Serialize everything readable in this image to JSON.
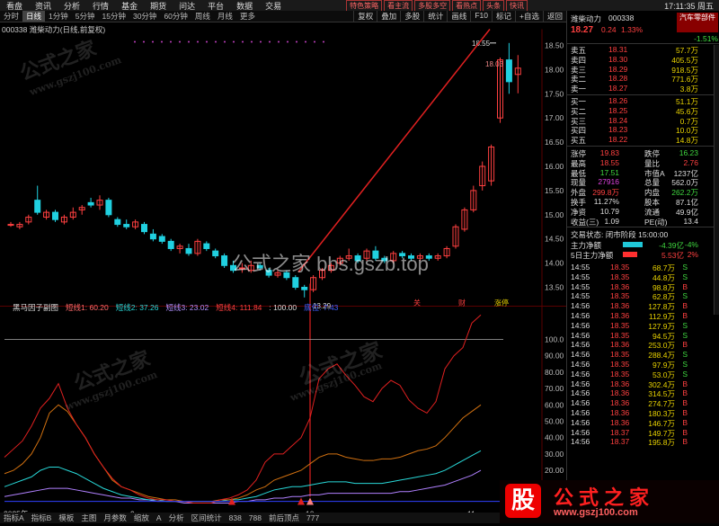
{
  "menu": {
    "items": [
      "看盘",
      "资讯",
      "分析",
      "行情",
      "基金",
      "期货",
      "问达",
      "平台",
      "数据",
      "交易"
    ],
    "chips": [
      "特色策略",
      "看主流",
      "多股多空",
      "看热点",
      "头条",
      "快讯"
    ],
    "clock": "17:11:35 周五"
  },
  "period": {
    "items": [
      "分时",
      "日线",
      "1分钟",
      "5分钟",
      "15分钟",
      "30分钟",
      "60分钟",
      "周线",
      "月线",
      "更多"
    ],
    "selected": "日线",
    "tools": [
      "复权",
      "叠加",
      "多股",
      "统计",
      "画线",
      "F10",
      "标记",
      "+自选",
      "返回"
    ]
  },
  "chart": {
    "title": "000338 潍柴动力(日线,前复权)",
    "price_axis": [
      "18.50",
      "18.00",
      "17.50",
      "17.00",
      "16.50",
      "16.00",
      "15.50",
      "15.00",
      "14.50",
      "14.00",
      "13.50"
    ],
    "high_label": "18.55",
    "low_label": "13.29",
    "last_label": "18.03",
    "date_labels": [
      "2025年",
      "9",
      "10",
      "11"
    ],
    "markers": [
      "关",
      "财",
      "涨停"
    ]
  },
  "indicator": {
    "name": "黑马因子副图",
    "values": [
      "短线1: 60.20",
      "短线2: 37.26",
      "短线3: 23.02",
      "短线4: 111.84",
      ": 100.00",
      "底位: 7.43"
    ],
    "axis": [
      "100.0",
      "90.00",
      "80.00",
      "70.00",
      "60.00",
      "50.00",
      "40.00",
      "30.00",
      "20.00",
      "10.00"
    ]
  },
  "bottom": {
    "items": [
      "指标A",
      "指标B",
      "模板",
      "主图",
      "月参数",
      "缩放",
      "A",
      "分析",
      "区间统计",
      "838",
      "788",
      "前后顶点",
      "777"
    ]
  },
  "quote": {
    "name": "潍柴动力",
    "code": "000338",
    "sector": "汽车零部件",
    "price": "18.27",
    "change": "0.24",
    "pct": "1.33%",
    "sector_pct": "-1.51%",
    "asks": [
      {
        "label": "卖五",
        "price": "18.31",
        "vol": "57.7万"
      },
      {
        "label": "卖四",
        "price": "18.30",
        "vol": "405.5万"
      },
      {
        "label": "卖三",
        "price": "18.29",
        "vol": "918.5万"
      },
      {
        "label": "卖二",
        "price": "18.28",
        "vol": "771.6万"
      },
      {
        "label": "卖一",
        "price": "18.27",
        "vol": "3.8万"
      }
    ],
    "bids": [
      {
        "label": "买一",
        "price": "18.26",
        "vol": "51.1万"
      },
      {
        "label": "买二",
        "price": "18.25",
        "vol": "45.6万"
      },
      {
        "label": "买三",
        "price": "18.24",
        "vol": "0.7万"
      },
      {
        "label": "买四",
        "price": "18.23",
        "vol": "10.0万"
      },
      {
        "label": "买五",
        "price": "18.22",
        "vol": "14.8万"
      }
    ],
    "stats": [
      {
        "l1": "涨停",
        "v1": "19.83",
        "l2": "跌停",
        "v2": "16.23"
      },
      {
        "l1": "最高",
        "v1": "18.55",
        "l2": "量比",
        "v2": "2.76"
      },
      {
        "l1": "最低",
        "v1": "17.51",
        "l2": "市值A",
        "v2": "1237亿"
      },
      {
        "l1": "现量",
        "v1": "27916",
        "l2": "总量",
        "v2": "562.0万"
      },
      {
        "l1": "外盘",
        "v1": "299.8万",
        "l2": "内盘",
        "v2": "262.2万"
      },
      {
        "l1": "换手",
        "v1": "11.27%",
        "l2": "股本",
        "v2": "87.1亿"
      },
      {
        "l1": "净资",
        "v1": "10.79",
        "l2": "流通",
        "v2": "49.9亿"
      },
      {
        "l1": "收益(三)",
        "v1": "1.09",
        "l2": "PE(动)",
        "v2": "13.4"
      }
    ],
    "trade_status": "交易状态: 闭市阶段 15:00:00",
    "flows": [
      {
        "label": "主力净额",
        "value": "-4.39亿",
        "pct": "-4%"
      },
      {
        "label": "5日主力净额",
        "value": "5.53亿",
        "pct": "2%"
      }
    ],
    "ticks": [
      {
        "t": "14:55",
        "p": "18.35",
        "v": "68.7万",
        "s": "S"
      },
      {
        "t": "14:55",
        "p": "18.35",
        "v": "44.8万",
        "s": "S"
      },
      {
        "t": "14:55",
        "p": "18.36",
        "v": "98.8万",
        "s": "B"
      },
      {
        "t": "14:55",
        "p": "18.35",
        "v": "62.8万",
        "s": "S"
      },
      {
        "t": "14:56",
        "p": "18.36",
        "v": "127.8万",
        "s": "B"
      },
      {
        "t": "14:56",
        "p": "18.36",
        "v": "112.9万",
        "s": "B"
      },
      {
        "t": "14:56",
        "p": "18.35",
        "v": "127.9万",
        "s": "S"
      },
      {
        "t": "14:56",
        "p": "18.35",
        "v": "94.5万",
        "s": "S"
      },
      {
        "t": "14:56",
        "p": "18.36",
        "v": "253.0万",
        "s": "B"
      },
      {
        "t": "14:56",
        "p": "18.35",
        "v": "288.4万",
        "s": "S"
      },
      {
        "t": "14:56",
        "p": "18.35",
        "v": "97.9万",
        "s": "S"
      },
      {
        "t": "14:56",
        "p": "18.35",
        "v": "53.0万",
        "s": "S"
      },
      {
        "t": "14:56",
        "p": "18.36",
        "v": "302.4万",
        "s": "B"
      },
      {
        "t": "14:56",
        "p": "18.36",
        "v": "314.5万",
        "s": "B"
      },
      {
        "t": "14:56",
        "p": "18.36",
        "v": "274.7万",
        "s": "B"
      },
      {
        "t": "14:56",
        "p": "18.36",
        "v": "180.3万",
        "s": "B"
      },
      {
        "t": "14:56",
        "p": "18.36",
        "v": "146.7万",
        "s": "B"
      },
      {
        "t": "14:56",
        "p": "18.37",
        "v": "149.7万",
        "s": "B"
      },
      {
        "t": "14:56",
        "p": "18.37",
        "v": "195.8万",
        "s": "B"
      }
    ]
  },
  "watermarks": [
    "公式之家",
    "www.gszj100.com",
    "公式之家 bbs.gszb.top",
    "股",
    "公式之家",
    "www.gszj100.com"
  ],
  "colors": {
    "up": "#ff4040",
    "down": "#20d0e0",
    "bg": "#000000"
  }
}
